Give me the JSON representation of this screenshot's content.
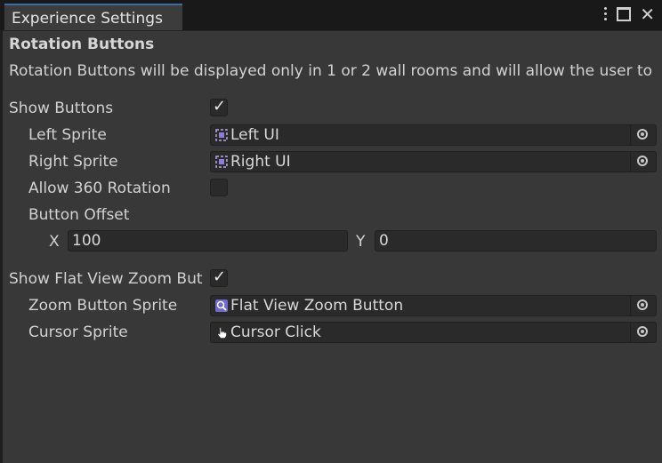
{
  "window": {
    "tab_title": "Experience Settings",
    "menu_icon": "kebab-menu-icon",
    "maximize_icon": "maximize-icon",
    "close_icon": "close-icon"
  },
  "section": {
    "header": "Rotation Buttons",
    "description": "Rotation Buttons will be displayed only in 1 or 2 wall rooms and will allow the user to"
  },
  "fields": {
    "show_buttons": {
      "label": "Show Buttons",
      "checked": true
    },
    "left_sprite": {
      "label": "Left Sprite",
      "value": "Left UI",
      "icon": "sprite-icon"
    },
    "right_sprite": {
      "label": "Right Sprite",
      "value": "Right UI",
      "icon": "sprite-icon"
    },
    "allow_360": {
      "label": "Allow 360 Rotation",
      "checked": false
    },
    "button_offset": {
      "label": "Button Offset",
      "x_label": "X",
      "x_value": "100",
      "y_label": "Y",
      "y_value": "0"
    },
    "show_flat_view": {
      "label": "Show Flat View Zoom But",
      "checked": true
    },
    "zoom_button_sprite": {
      "label": "Zoom Button Sprite",
      "value": "Flat View Zoom Button",
      "icon": "zoom-sprite-icon"
    },
    "cursor_sprite": {
      "label": "Cursor Sprite",
      "value": "Cursor Click",
      "icon": "hand-cursor-icon"
    }
  },
  "colors": {
    "background": "#383838",
    "titlebar": "#191919",
    "field": "#2a2a2a",
    "accent": "#3d6ea3"
  }
}
